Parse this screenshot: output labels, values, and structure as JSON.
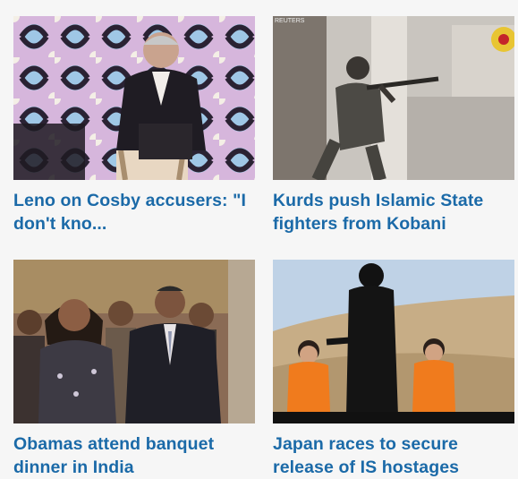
{
  "stories": [
    {
      "headline": "Leno on Cosby accusers: \"I don't kno...",
      "image": "jay-leno-seated-on-stage"
    },
    {
      "headline": "Kurds push Islamic State fighters from Kobani",
      "image": "fighter-aiming-rifle",
      "watermark": "REUTERS"
    },
    {
      "headline": "Obamas attend banquet dinner in India",
      "image": "obamas-with-honor-guard"
    },
    {
      "headline": "Japan races to secure release of IS hostages",
      "image": "hostages-in-desert"
    }
  ],
  "colors": {
    "headline": "#1b6aa8",
    "background": "#f6f6f6"
  }
}
